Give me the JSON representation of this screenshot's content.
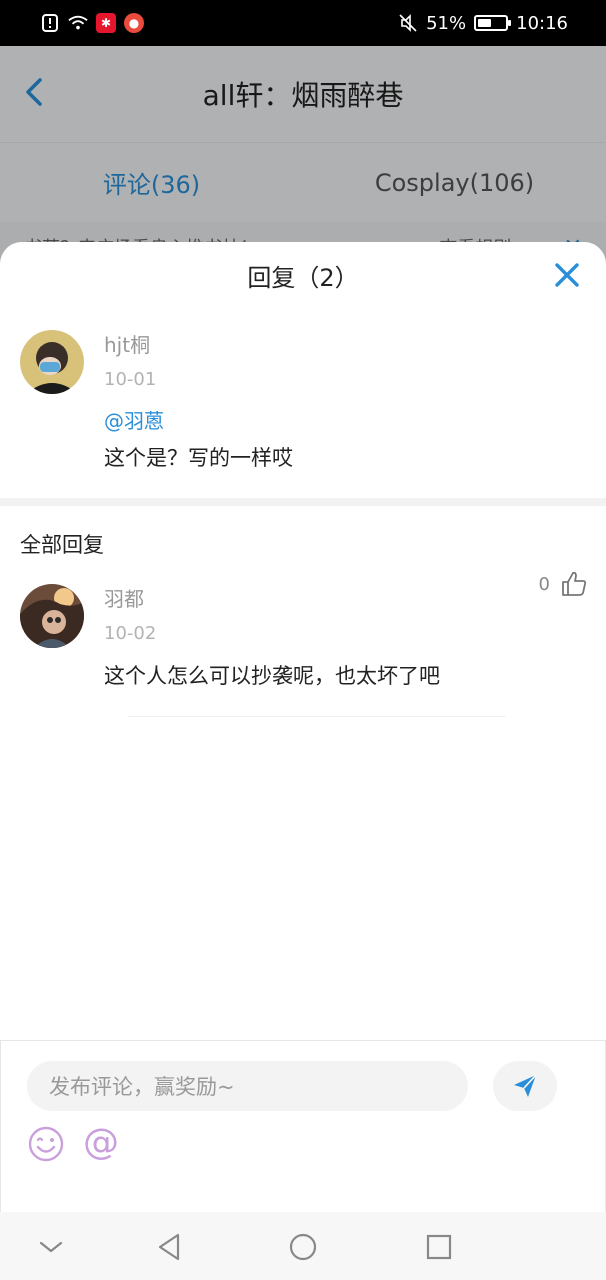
{
  "status_bar": {
    "battery": "51%",
    "time": "10:16",
    "battery_level": 0.51
  },
  "background_page": {
    "title": "all轩：烟雨醉巷",
    "tabs": [
      {
        "label": "评论(36)",
        "active": true
      },
      {
        "label": "Cosplay(106)",
        "active": false
      }
    ],
    "notice": {
      "text": "书荒？来广场看良心推书帖！",
      "rules_link": "查看规则>>"
    }
  },
  "sheet": {
    "title": "回复（2）",
    "original_comment": {
      "author": "hjt桐",
      "date": "10-01",
      "mention": "@羽蒽",
      "text": "这个是？写的一样哎"
    },
    "section_title": "全部回复",
    "replies": [
      {
        "author": "羽都",
        "date": "10-02",
        "likes": "0",
        "text": "这个人怎么可以抄袭呢，也太坏了吧"
      }
    ]
  },
  "composer": {
    "placeholder": "发布评论，赢奖励~",
    "at_symbol": "@"
  },
  "colors": {
    "accent": "#2a8fd8",
    "emoji_purple": "#c9a0dc",
    "text_primary": "#222222",
    "text_secondary": "#999999"
  },
  "icons": [
    "back-icon",
    "close-icon",
    "thumb-up-icon",
    "send-icon",
    "emoji-icon",
    "at-icon",
    "nav-down-icon",
    "nav-back-icon",
    "nav-home-icon",
    "nav-recents-icon"
  ]
}
